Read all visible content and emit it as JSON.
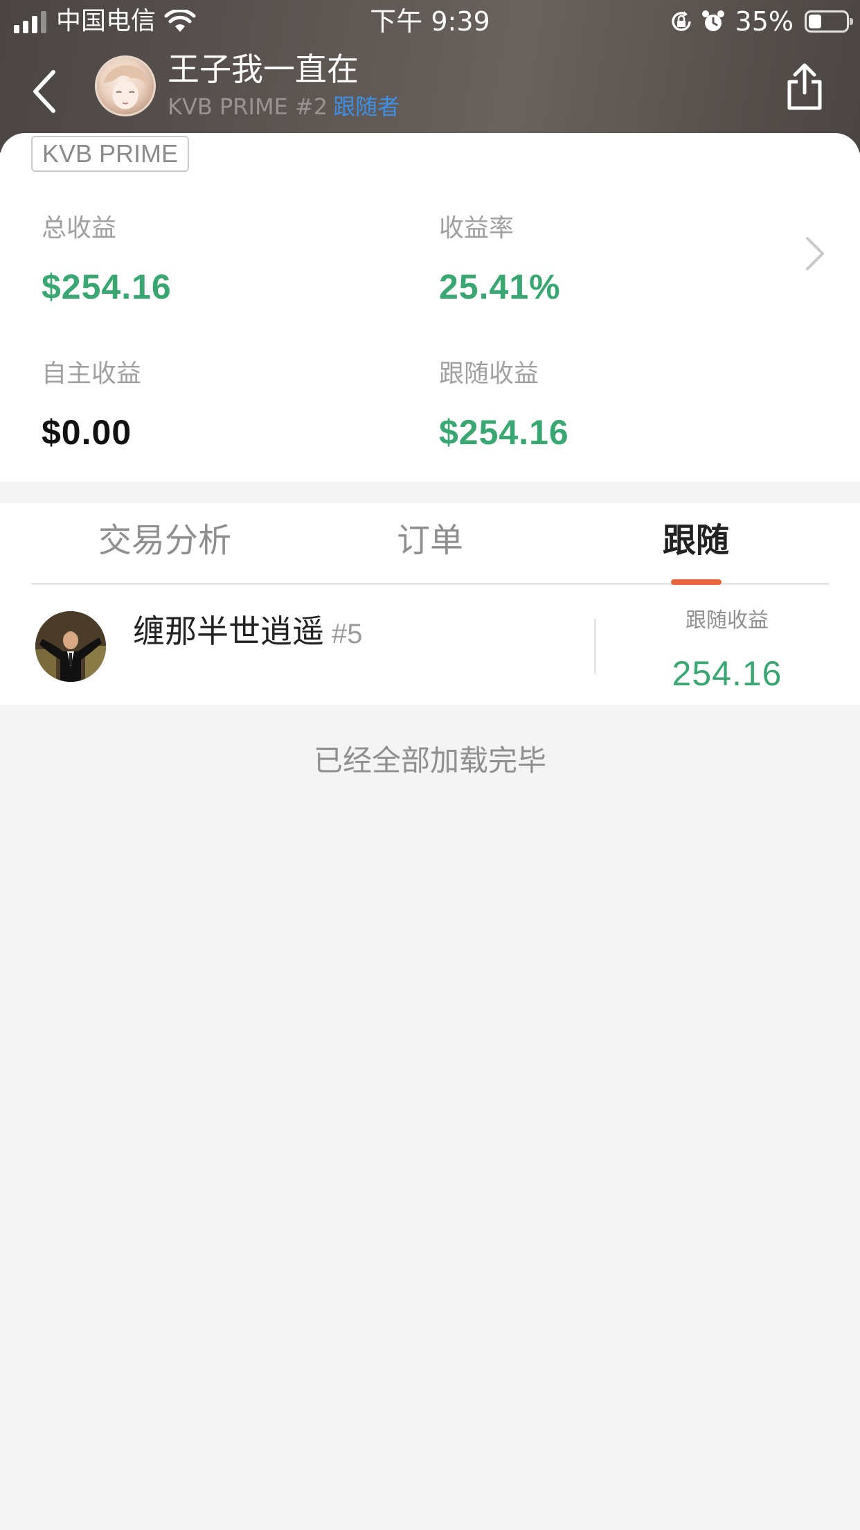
{
  "status_bar": {
    "carrier": "中国电信",
    "time": "下午 9:39",
    "battery_percent": "35%",
    "battery_level": 0.35
  },
  "header": {
    "profile_name": "王子我一直在",
    "rank": "KVB PRIME #2",
    "role": "跟随者"
  },
  "stats": {
    "badge": "KVB PRIME",
    "total_label": "总收益",
    "total_value": "$254.16",
    "rate_label": "收益率",
    "rate_value": "25.41%",
    "self_label": "自主收益",
    "self_value": "$0.00",
    "follow_label": "跟随收益",
    "follow_value": "$254.16"
  },
  "tabs": [
    {
      "label": "交易分析",
      "active": false
    },
    {
      "label": "订单",
      "active": false
    },
    {
      "label": "跟随",
      "active": true
    }
  ],
  "followers": [
    {
      "name": "缠那半世逍遥",
      "rank": "#5",
      "metric_label": "跟随收益",
      "metric_value": "254.16"
    }
  ],
  "footer": {
    "load_complete": "已经全部加载完毕"
  },
  "colors": {
    "positive": "#3aa672",
    "accent_link": "#3e8fe6",
    "tab_indicator": "#e8663a"
  }
}
